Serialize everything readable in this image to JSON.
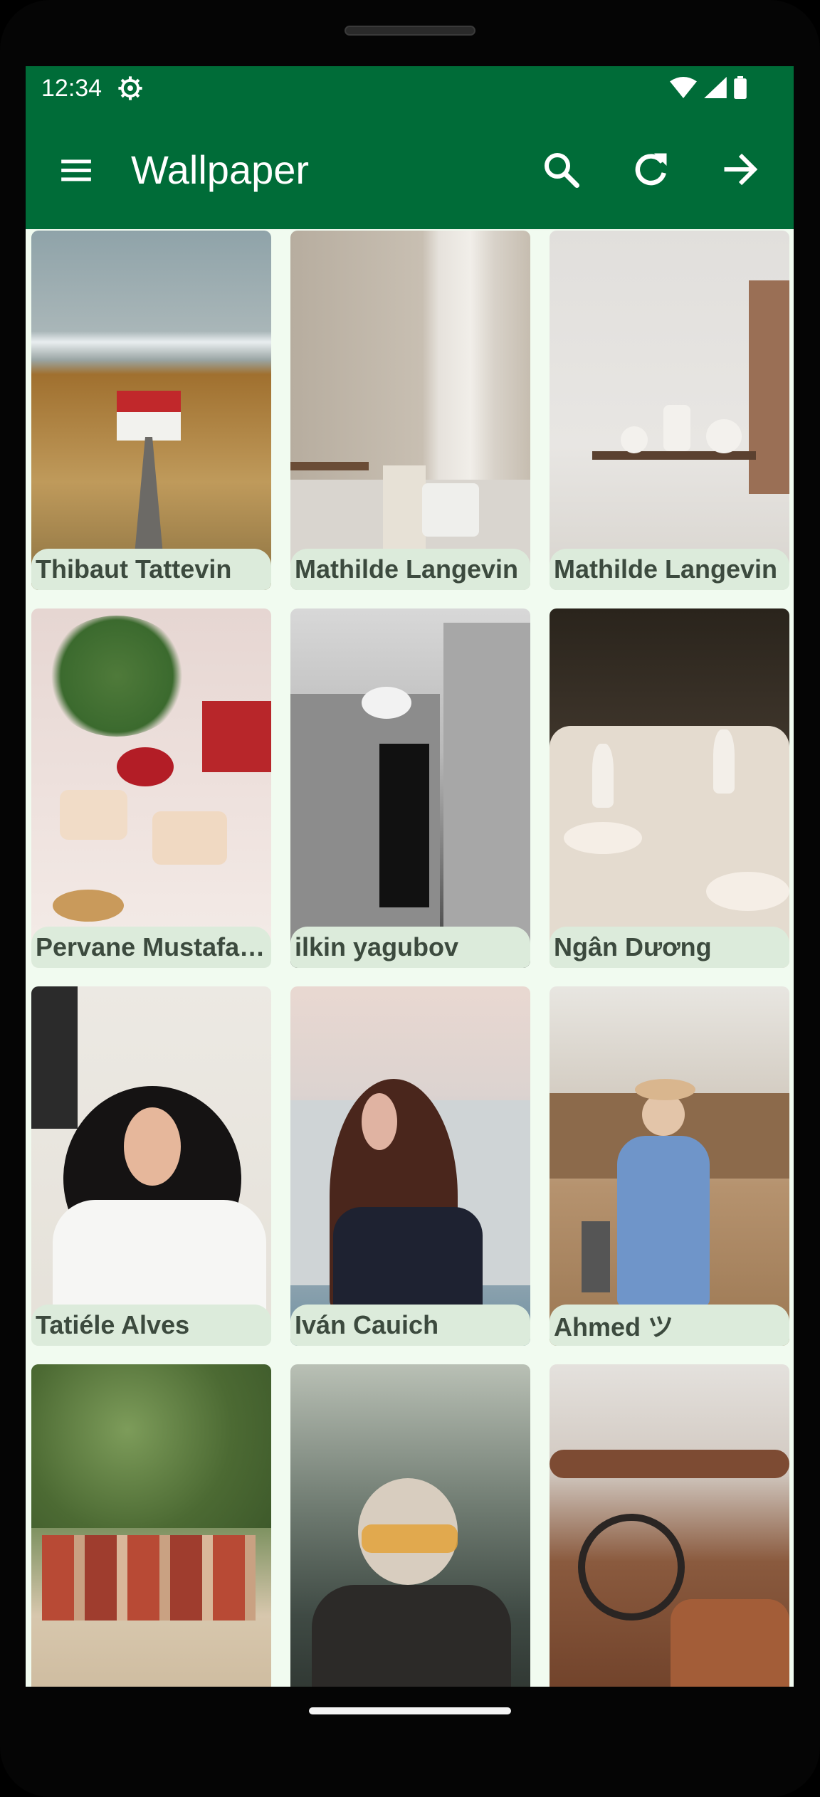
{
  "status_bar": {
    "time": "12:34",
    "icons": [
      "settings-gear-icon",
      "wifi-icon",
      "signal-icon",
      "battery-icon"
    ]
  },
  "app_bar": {
    "title": "Wallpaper",
    "actions": [
      "search-icon",
      "refresh-icon",
      "arrow-forward-icon"
    ],
    "menu_icon": "menu-icon",
    "background": "#006c38"
  },
  "photos": [
    {
      "author": "Thibaut Tattevin"
    },
    {
      "author": "Mathilde Langevin"
    },
    {
      "author": "Mathilde Langevin"
    },
    {
      "author": "Pervane Mustafa ..."
    },
    {
      "author": "ilkin yagubov"
    },
    {
      "author": "Ngân Dương"
    },
    {
      "author": "Tatiéle Alves"
    },
    {
      "author": "Iván Cauich"
    },
    {
      "author": "Ahmed ツ"
    },
    {
      "author": ""
    },
    {
      "author": ""
    },
    {
      "author": ""
    }
  ],
  "colors": {
    "accent": "#006c38",
    "surface": "#f1fbf0",
    "chip": "#dcebdb",
    "chip_text": "#3c4a3e"
  }
}
